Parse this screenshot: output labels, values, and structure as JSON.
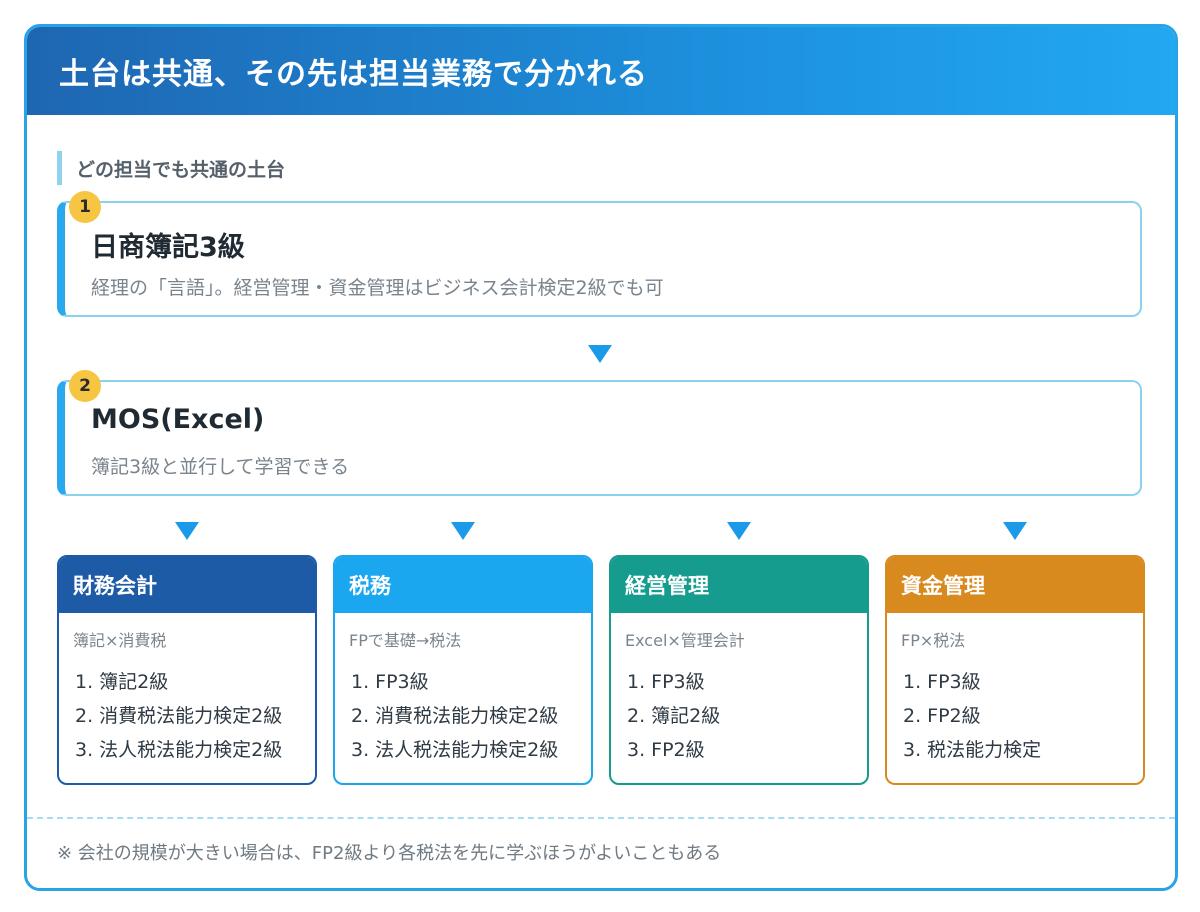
{
  "header": {
    "title": "土台は共通、その先は担当業務で分かれる"
  },
  "common_label": "どの担当でも共通の土台",
  "steps": [
    {
      "badge": "1",
      "title": "日商簿記3級",
      "desc": "経理の「言語」。経営管理・資金管理はビジネス会計検定2級でも可"
    },
    {
      "badge": "2",
      "title": "MOS(Excel)",
      "desc": "簿記3級と並行して学習できる"
    }
  ],
  "cards": [
    {
      "title": "財務会計",
      "sub": "簿記×消費税",
      "items": [
        "1. 簿記2級",
        "2. 消費税法能力検定2級",
        "3. 法人税法能力検定2級"
      ],
      "color": "#1d5ba7"
    },
    {
      "title": "税務",
      "sub": "FPで基礎→税法",
      "items": [
        "1. FP3級",
        "2. 消費税法能力検定2級",
        "3. 法人税法能力検定2級"
      ],
      "color": "#1ba6f0"
    },
    {
      "title": "経営管理",
      "sub": "Excel×管理会計",
      "items": [
        "1. FP3級",
        "2. 簿記2級",
        "3. FP2級"
      ],
      "color": "#159c8f"
    },
    {
      "title": "資金管理",
      "sub": "FP×税法",
      "items": [
        "1. FP3級",
        "2. FP2級",
        "3. 税法能力検定"
      ],
      "color": "#d98a1e"
    }
  ],
  "note": "※ 会社の規模が大きい場合は、FP2級より各税法を先に学ぶほうがよいこともある",
  "colors": {
    "accent": "#27a3e6",
    "badge": "#f6c542",
    "arrow": "#1a9ae8"
  }
}
